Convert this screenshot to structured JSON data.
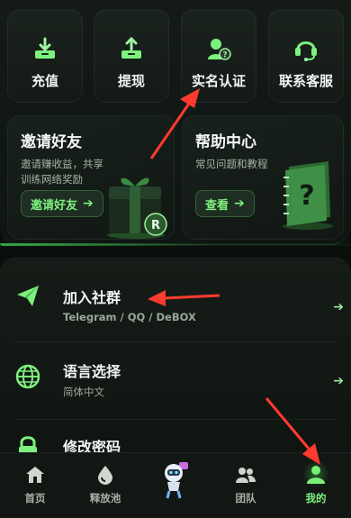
{
  "quick_actions": [
    {
      "label": "充值",
      "icon": "deposit-tray-icon"
    },
    {
      "label": "提现",
      "icon": "withdraw-tray-icon"
    },
    {
      "label": "实名认证",
      "icon": "user-verify-icon"
    },
    {
      "label": "联系客服",
      "icon": "headset-icon"
    }
  ],
  "invite_card": {
    "title": "邀请好友",
    "desc_line1": "邀请赚收益，共享",
    "desc_line2": "训练网络奖励",
    "button": "邀请好友",
    "image": "gift-box-icon"
  },
  "help_card": {
    "title": "帮助中心",
    "desc": "常见问题和教程",
    "button": "查看",
    "image": "question-book-icon"
  },
  "settings": [
    {
      "title": "加入社群",
      "subtitle": "Telegram / QQ / DeBOX",
      "icon": "paper-plane-icon"
    },
    {
      "title": "语言选择",
      "subtitle": "简体中文",
      "icon": "globe-icon"
    },
    {
      "title": "修改密码",
      "subtitle": "",
      "icon": "lock-icon"
    }
  ],
  "tabs": [
    {
      "label": "首页",
      "icon": "home-icon"
    },
    {
      "label": "释放池",
      "icon": "drop-icon"
    },
    {
      "label": "",
      "icon": "robot-mascot-icon"
    },
    {
      "label": "团队",
      "icon": "team-icon"
    },
    {
      "label": "我的",
      "icon": "profile-icon",
      "active": true
    }
  ],
  "colors": {
    "accent": "#7ef07e",
    "background": "#0b0f0c",
    "annotation_arrow": "#ff3b2f"
  }
}
